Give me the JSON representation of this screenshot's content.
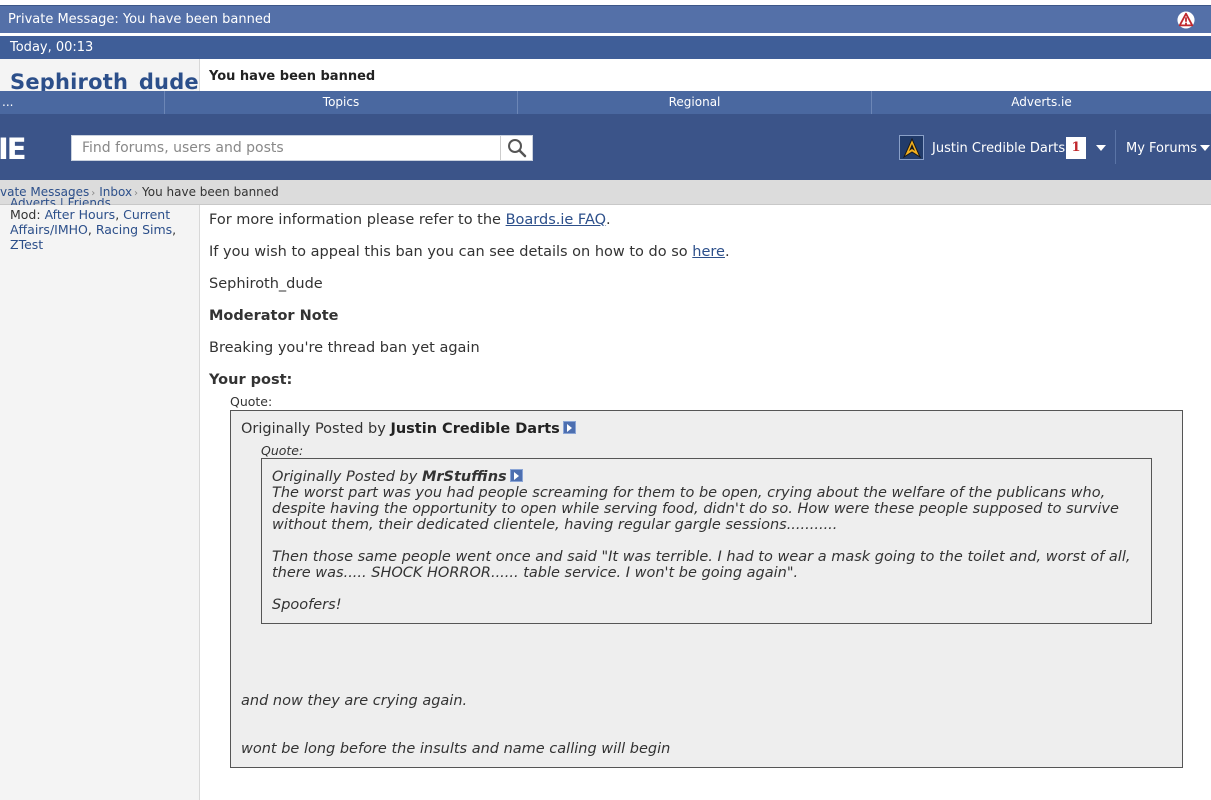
{
  "pm_title": "Private Message: You have been banned",
  "date": "Today, 00:13",
  "sender": "Sephiroth_dude",
  "subject": "You have been banned",
  "nav": {
    "first": "...",
    "tabs": [
      "Topics",
      "Regional",
      "Adverts.ie"
    ]
  },
  "header": {
    "logo": "IE",
    "search_placeholder": "Find forums, users and posts",
    "user_name": "Justin Credible Darts",
    "notification_count": "1",
    "my_forums": "My Forums"
  },
  "breadcrumb": {
    "items": [
      "vate Messages",
      "Inbox"
    ],
    "current": "You have been banned"
  },
  "left_info": {
    "cut_text": "Adverts | Friends",
    "mod_label": "Mod:",
    "mod_forums": [
      "After Hours",
      "Current Affairs/IMHO",
      "Racing Sims",
      "ZTest"
    ]
  },
  "message": {
    "faq_prefix": "For more information please refer to the ",
    "faq_link": "Boards.ie FAQ",
    "faq_suffix": ".",
    "appeal_prefix": "If you wish to appeal this ban you can see details on how to do so ",
    "appeal_link": "here",
    "appeal_suffix": ".",
    "signature": "Sephiroth_dude",
    "mod_note_heading": "Moderator Note",
    "mod_note": "Breaking you're thread ban yet again",
    "your_post_heading": "Your post:",
    "quote_label": "Quote:"
  },
  "outer_quote": {
    "by_prefix": "Originally Posted by ",
    "author": "Justin Credible Darts",
    "inner_label": "Quote:",
    "line1": "and now they are crying again.",
    "line2": "wont be long before the insults and name calling will begin"
  },
  "inner_quote": {
    "by_prefix": "Originally Posted by ",
    "author": "MrStuffins",
    "p1": "The worst part was you had people screaming for them to be open, crying about the welfare of the publicans who, despite having the opportunity to open while serving food, didn't do so. How were these people supposed to survive without them, their dedicated clientele, having regular gargle sessions...........",
    "p2": "Then those same people went once and said \"It was terrible. I had to wear a mask going to the toilet and, worst of all, there was..... SHOCK HORROR...... table service. I won't be going again\".",
    "p3": "Spoofers!"
  },
  "colors": {
    "titlebar": "#5470a8",
    "header": "#3b5489",
    "link": "#2c4f8a",
    "warning": "#c0282d"
  },
  "icons": [
    "warning-icon",
    "search-icon",
    "avatar-icon",
    "chevron-down-icon",
    "view-post-arrow-icon"
  ]
}
